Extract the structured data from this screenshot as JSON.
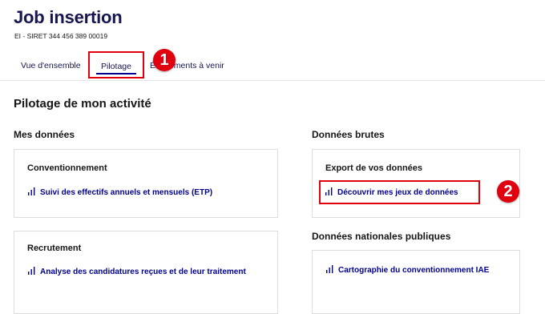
{
  "header": {
    "title": "Job insertion",
    "siret": "EI - SIRET 344 456 389 00019"
  },
  "tabs": {
    "overview": "Vue d'ensemble",
    "pilotage": "Pilotage",
    "events": "Évènements à venir"
  },
  "markers": {
    "one": "1",
    "two": "2"
  },
  "main": {
    "section_title": "Pilotage de mon activité",
    "left_column": {
      "title": "Mes données",
      "cards": [
        {
          "title": "Conventionnement",
          "link": "Suivi des effectifs annuels et mensuels (ETP)"
        },
        {
          "title": "Recrutement",
          "link": "Analyse des candidatures reçues et de leur traitement"
        }
      ]
    },
    "right_column": {
      "raw_title": "Données brutes",
      "export_card": {
        "title": "Export de vos données",
        "link": "Découvrir mes jeux de données"
      },
      "national_title": "Données nationales publiques",
      "national_card": {
        "link": "Cartographie du conventionnement IAE"
      }
    }
  },
  "colors": {
    "accent": "#000091",
    "highlight": "#e1000f"
  },
  "icons": {
    "link_icon": "bar-chart-icon"
  }
}
